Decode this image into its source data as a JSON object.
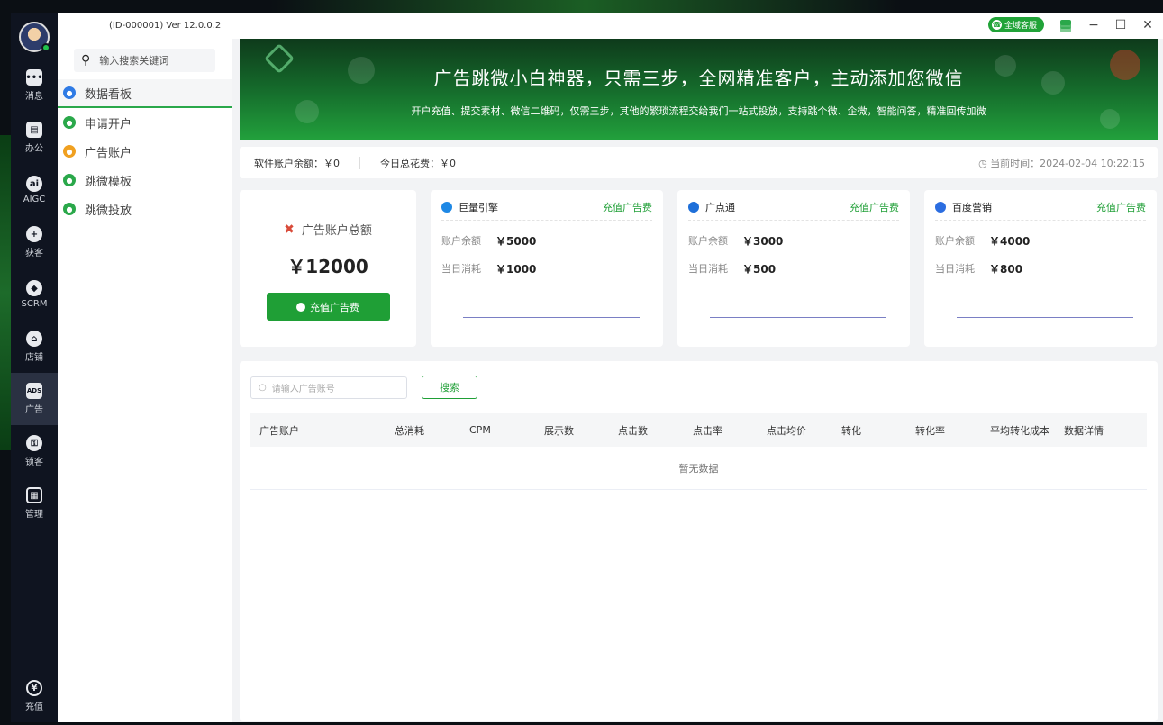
{
  "window": {
    "title": "(ID-000001)  Ver 12.0.0.2",
    "service_button": "全域客服"
  },
  "rail": {
    "items": [
      {
        "label": "消息",
        "icon": "chat-icon"
      },
      {
        "label": "办公",
        "icon": "office-icon"
      },
      {
        "label": "AIGC",
        "icon": "ai-icon"
      },
      {
        "label": "获客",
        "icon": "user-add-icon"
      },
      {
        "label": "SCRM",
        "icon": "scrm-icon"
      },
      {
        "label": "店铺",
        "icon": "shop-icon"
      },
      {
        "label": "广告",
        "icon": "ads-icon"
      },
      {
        "label": "锁客",
        "icon": "user-lock-icon"
      },
      {
        "label": "管理",
        "icon": "grid-icon"
      }
    ],
    "recharge_label": "充值"
  },
  "sidenav": {
    "search_placeholder": "输入搜索关键词",
    "items": [
      {
        "label": "数据看板",
        "color": "#2f7be5"
      },
      {
        "label": "申请开户",
        "color": "#2aa84a"
      },
      {
        "label": "广告账户",
        "color": "#f0a020"
      },
      {
        "label": "跳微模板",
        "color": "#2aa84a"
      },
      {
        "label": "跳微投放",
        "color": "#2aa84a"
      }
    ]
  },
  "banner": {
    "title": "广告跳微小白神器，只需三步，全网精准客户，主动添加您微信",
    "subtitle": "开户充值、提交素材、微信二维码，仅需三步，其他的繁琐流程交给我们一站式投放，支持跳个微、企微，智能问答，精准回传加微"
  },
  "info": {
    "software_balance": "软件账户余额：￥0",
    "today_spend": "今日总花费：￥0",
    "current_time": "当前时间：2024-02-04 10:22:15"
  },
  "total_card": {
    "label": "广告账户总额",
    "amount": "￥12000",
    "button": "充值广告费"
  },
  "platforms": [
    {
      "name": "巨量引擎",
      "recharge": "充值广告费",
      "balance_label": "账户余额",
      "balance": "￥5000",
      "spend_label": "当日消耗",
      "spend": "￥1000",
      "color": "#1e88e5"
    },
    {
      "name": "广点通",
      "recharge": "充值广告费",
      "balance_label": "账户余额",
      "balance": "￥3000",
      "spend_label": "当日消耗",
      "spend": "￥500",
      "color": "#1e6fd9"
    },
    {
      "name": "百度营销",
      "recharge": "充值广告费",
      "balance_label": "账户余额",
      "balance": "￥4000",
      "spend_label": "当日消耗",
      "spend": "￥800",
      "color": "#2b6de0"
    }
  ],
  "table": {
    "search_placeholder": "请输入广告账号",
    "search_button": "搜索",
    "columns": [
      "广告账户",
      "总消耗",
      "CPM",
      "展示数",
      "点击数",
      "点击率",
      "点击均价",
      "转化",
      "转化率",
      "平均转化成本",
      "数据详情"
    ],
    "empty_text": "暂无数据"
  }
}
